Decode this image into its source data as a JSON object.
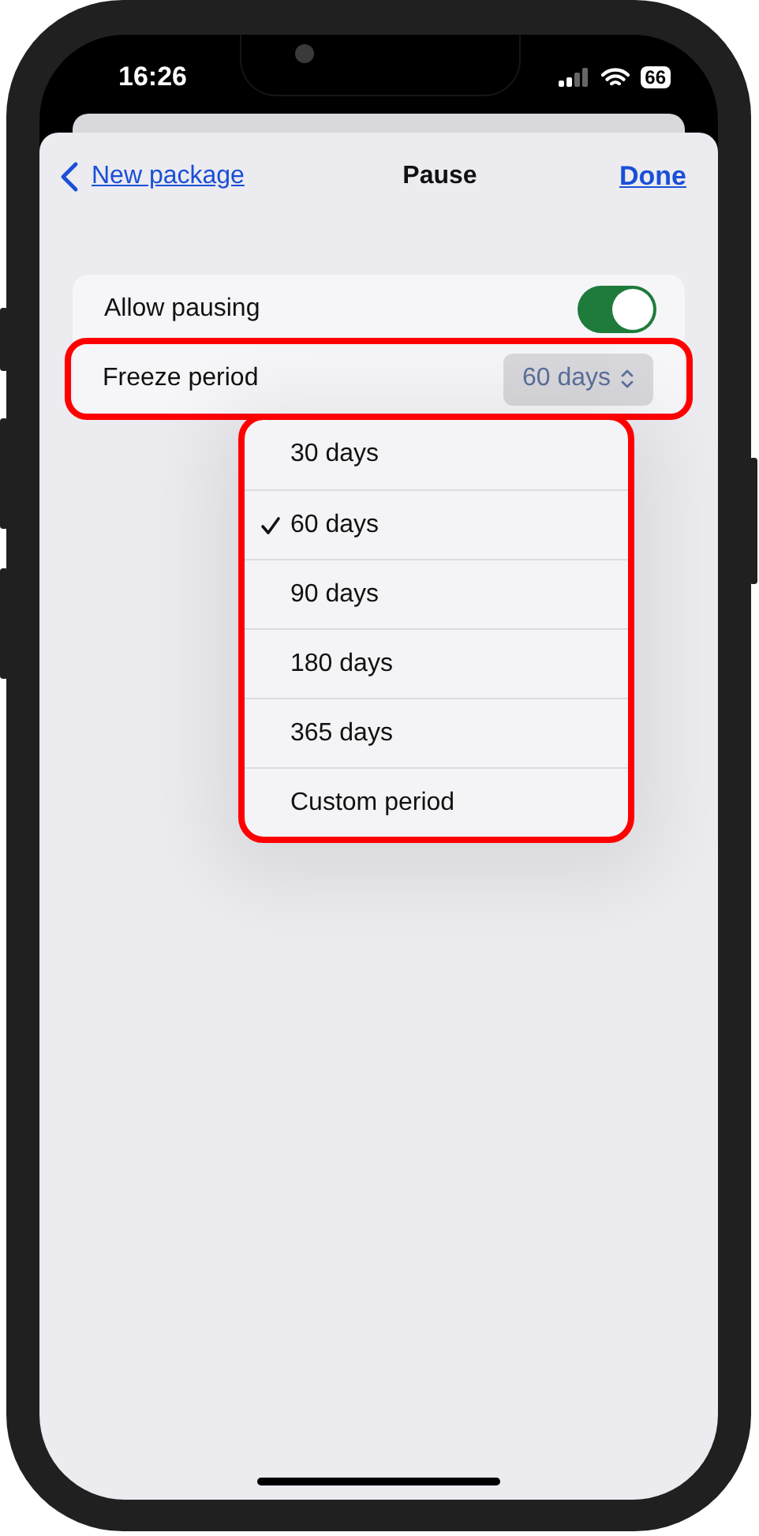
{
  "status_bar": {
    "time": "16:26",
    "battery": "66"
  },
  "nav": {
    "back": "New package",
    "title": "Pause",
    "done": "Done"
  },
  "settings": [
    {
      "kind": "toggle",
      "label": "Allow pausing",
      "on": true,
      "highlighted": false
    },
    {
      "kind": "picker",
      "label": "Freeze period",
      "value": "60 days",
      "highlighted": true
    }
  ],
  "menu": {
    "highlighted": true,
    "items": [
      {
        "label": "30 days",
        "selected": false
      },
      {
        "label": "60 days",
        "selected": true
      },
      {
        "label": "90 days",
        "selected": false
      },
      {
        "label": "180 days",
        "selected": false
      },
      {
        "label": "365 days",
        "selected": false
      },
      {
        "label": "Custom period",
        "selected": false
      }
    ]
  }
}
